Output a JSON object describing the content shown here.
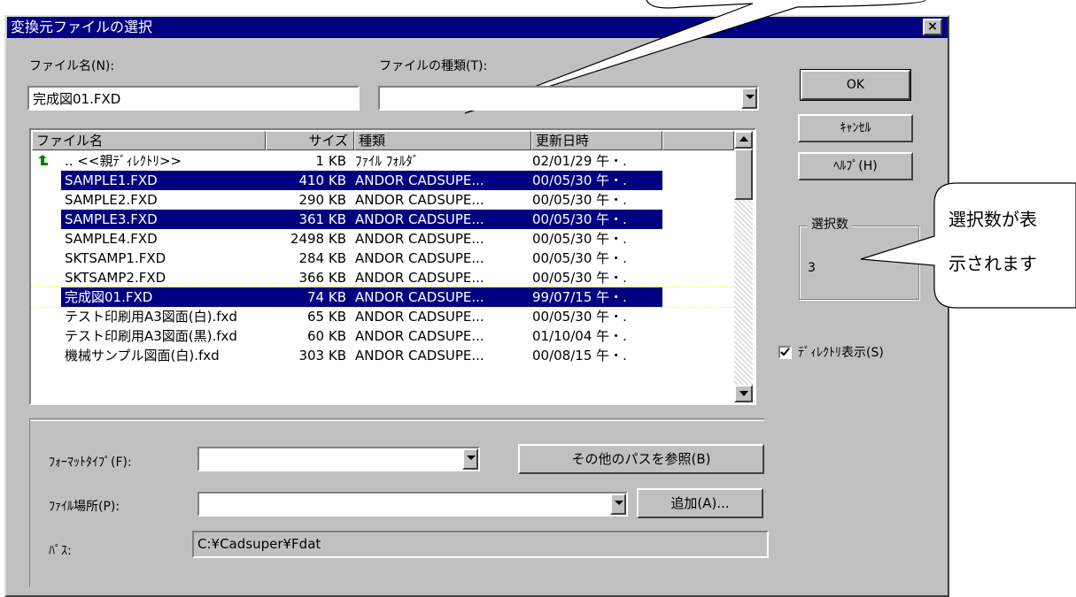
{
  "dialog": {
    "title": "変換元ファイルの選択",
    "close_label": "×",
    "filename_label": "ファイル名(N):",
    "filename_value": "完成図01.FXD",
    "filetype_label": "ファイルの種類(T):",
    "filetype_value": "",
    "ok_label": "OK",
    "cancel_label": "ｷｬﾝｾﾙ",
    "help_label": "ﾍﾙﾌﾟ(H)",
    "selection_group_label": "選択数",
    "selection_count": "3",
    "dir_checkbox_label": "ﾃﾞｨﾚｸﾄﾘ表示(S)",
    "dir_checkbox_checked": true
  },
  "file_list": {
    "columns": [
      "ファイル名",
      "サイズ",
      "種類",
      "更新日時"
    ],
    "rows": [
      {
        "name": ".. <<親ﾃﾞｨﾚｸﾄﾘ>>",
        "size": "1 KB",
        "type": "ﾌｧｲﾙ ﾌｫﾙﾀﾞ",
        "date": "02/01/29 午・.",
        "selected": false,
        "icon": "parent-folder-arrow-icon"
      },
      {
        "name": "SAMPLE1.FXD",
        "size": "410 KB",
        "type": "ANDOR CADSUPE...",
        "date": "00/05/30 午・.",
        "selected": true
      },
      {
        "name": "SAMPLE2.FXD",
        "size": "290 KB",
        "type": "ANDOR CADSUPE...",
        "date": "00/05/30 午・.",
        "selected": false
      },
      {
        "name": "SAMPLE3.FXD",
        "size": "361 KB",
        "type": "ANDOR CADSUPE...",
        "date": "00/05/30 午・.",
        "selected": true
      },
      {
        "name": "SAMPLE4.FXD",
        "size": "2498 KB",
        "type": "ANDOR CADSUPE...",
        "date": "00/05/30 午・.",
        "selected": false
      },
      {
        "name": "SKTSAMP1.FXD",
        "size": "284 KB",
        "type": "ANDOR CADSUPE...",
        "date": "00/05/30 午・.",
        "selected": false
      },
      {
        "name": "SKTSAMP2.FXD",
        "size": "366 KB",
        "type": "ANDOR CADSUPE...",
        "date": "00/05/30 午・.",
        "selected": false
      },
      {
        "name": "完成図01.FXD",
        "size": "74 KB",
        "type": "ANDOR CADSUPE...",
        "date": "99/07/15 午・.",
        "selected": true
      },
      {
        "name": "テスト印刷用A3図面(白).fxd",
        "size": "65 KB",
        "type": "ANDOR CADSUPE...",
        "date": "00/05/30 午・.",
        "selected": false
      },
      {
        "name": "テスト印刷用A3図面(黒).fxd",
        "size": "60 KB",
        "type": "ANDOR CADSUPE...",
        "date": "01/10/04 午・.",
        "selected": false
      },
      {
        "name": "機械サンプル図面(白).fxd",
        "size": "303 KB",
        "type": "ANDOR CADSUPE...",
        "date": "00/08/15 午・.",
        "selected": false
      }
    ]
  },
  "bottom": {
    "format_label": "ﾌｫｰﾏｯﾄﾀｲﾌﾟ(F):",
    "format_value": "",
    "other_path_button": "その他のパスを参照(B)",
    "location_label": "ﾌｧｲﾙ場所(P):",
    "location_value": "",
    "add_button": "追加(A)...",
    "path_label": "ﾊﾟｽ:",
    "path_value": "C:¥Cadsuper¥Fdat"
  },
  "callout": {
    "text_line1": "選択数が表",
    "text_line2": "示されます"
  }
}
